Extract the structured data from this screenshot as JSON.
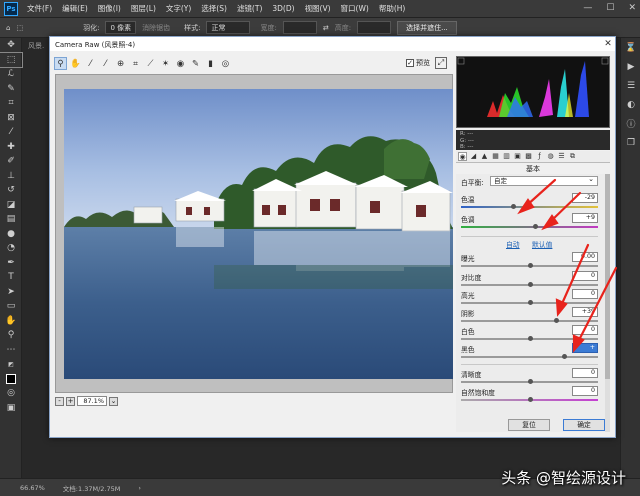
{
  "menubar": {
    "logo": "Ps",
    "items": [
      "文件(F)",
      "编辑(E)",
      "图像(I)",
      "图层(L)",
      "文字(Y)",
      "选择(S)",
      "滤镜(T)",
      "3D(D)",
      "视图(V)",
      "窗口(W)",
      "帮助(H)"
    ],
    "window_controls": [
      "—",
      "☐",
      "✕"
    ]
  },
  "options_bar": {
    "feather_label": "羽化:",
    "feather_value": "0 像素",
    "antialias_label": "消除锯齿",
    "style_label": "样式:",
    "style_value": "正常",
    "width_label": "宽度:",
    "height_label": "高度:",
    "select_mask_button": "选择并遮住..."
  },
  "document_tab": "风景.",
  "status_bar": {
    "zoom": "66.67%",
    "doc_info": "文档:1.37M/2.75M"
  },
  "dialog": {
    "title": "Camera Raw (风景照-4)",
    "close": "✕",
    "preview_label": "预览",
    "preview_checked": "✓",
    "zoom_level": "87.1%",
    "zoom_minus": "-",
    "zoom_plus": "+",
    "panel_title": "基本",
    "rgb": {
      "r": "R:  ---",
      "g": "G:  ---",
      "b": "B:  ---"
    },
    "white_balance": {
      "label": "白平衡:",
      "value": "自定"
    },
    "auto_link": "自动",
    "default_link": "默认值",
    "sliders": [
      {
        "label": "色温",
        "value": "-29",
        "level": 0.38
      },
      {
        "label": "色调",
        "value": "+9",
        "level": 0.54
      },
      {
        "label": "曝光",
        "value": "0.00",
        "level": 0.5
      },
      {
        "label": "对比度",
        "value": "0",
        "level": 0.5
      },
      {
        "label": "高光",
        "value": "0",
        "level": 0.5
      },
      {
        "label": "阴影",
        "value": "+39",
        "level": 0.695
      },
      {
        "label": "白色",
        "value": "0",
        "level": 0.5
      },
      {
        "label": "黑色",
        "value": "+",
        "level": 0.75
      },
      {
        "label": "清晰度",
        "value": "0",
        "level": 0.5
      },
      {
        "label": "自然饱和度",
        "value": "0",
        "level": 0.5
      }
    ],
    "cancel_button": "复位",
    "ok_button": "确定"
  },
  "watermark": "头条 @智绘源设计",
  "colors": {
    "ps_background": "#282828",
    "dialog_background": "#f0f0f0",
    "annotation_arrow": "#e8231c",
    "selected_value": "#3b7bd4"
  }
}
